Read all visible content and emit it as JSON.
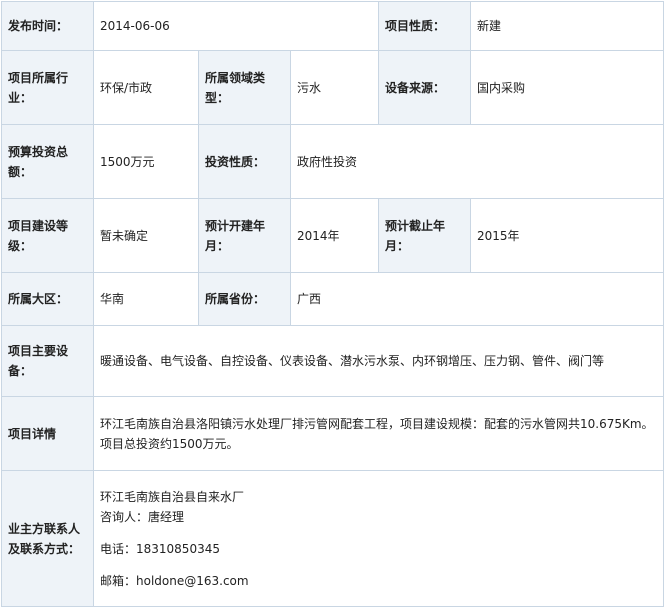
{
  "rows": {
    "publish_time": {
      "label": "发布时间：",
      "value": "2014-06-06"
    },
    "project_nature": {
      "label": "项目性质：",
      "value": "新建"
    },
    "industry": {
      "label": "项目所属行业：",
      "value": "环保/市政"
    },
    "field_type": {
      "label": "所属领域类型：",
      "value": "污水"
    },
    "equipment_source": {
      "label": "设备来源：",
      "value": "国内采购"
    },
    "budget": {
      "label": "预算投资总额：",
      "value": "1500万元"
    },
    "investment_nature": {
      "label": "投资性质：",
      "value": "政府性投资"
    },
    "grade": {
      "label": "项目建设等级：",
      "value": "暂未确定"
    },
    "start_year": {
      "label": "预计开建年月：",
      "value": "2014年"
    },
    "end_year": {
      "label": "预计截止年月：",
      "value": "2015年"
    },
    "region": {
      "label": "所属大区：",
      "value": "华南"
    },
    "province": {
      "label": "所属省份：",
      "value": "广西"
    },
    "main_equipment": {
      "label": "项目主要设备：",
      "value": "暖通设备、电气设备、自控设备、仪表设备、潜水污水泵、内环钢增压、压力钢、管件、阀门等"
    },
    "details": {
      "label": "项目详情",
      "value": "环江毛南族自治县洛阳镇污水处理厂排污管网配套工程，项目建设规模：配套的污水管网共10.675Km。项目总投资约1500万元。"
    },
    "contact": {
      "label": "业主方联系人及联系方式：",
      "org": "环江毛南族自治县自来水厂",
      "consultant": "咨询人：唐经理",
      "phone": "电话：18310850345",
      "email": "邮箱：holdone@163.com"
    }
  }
}
